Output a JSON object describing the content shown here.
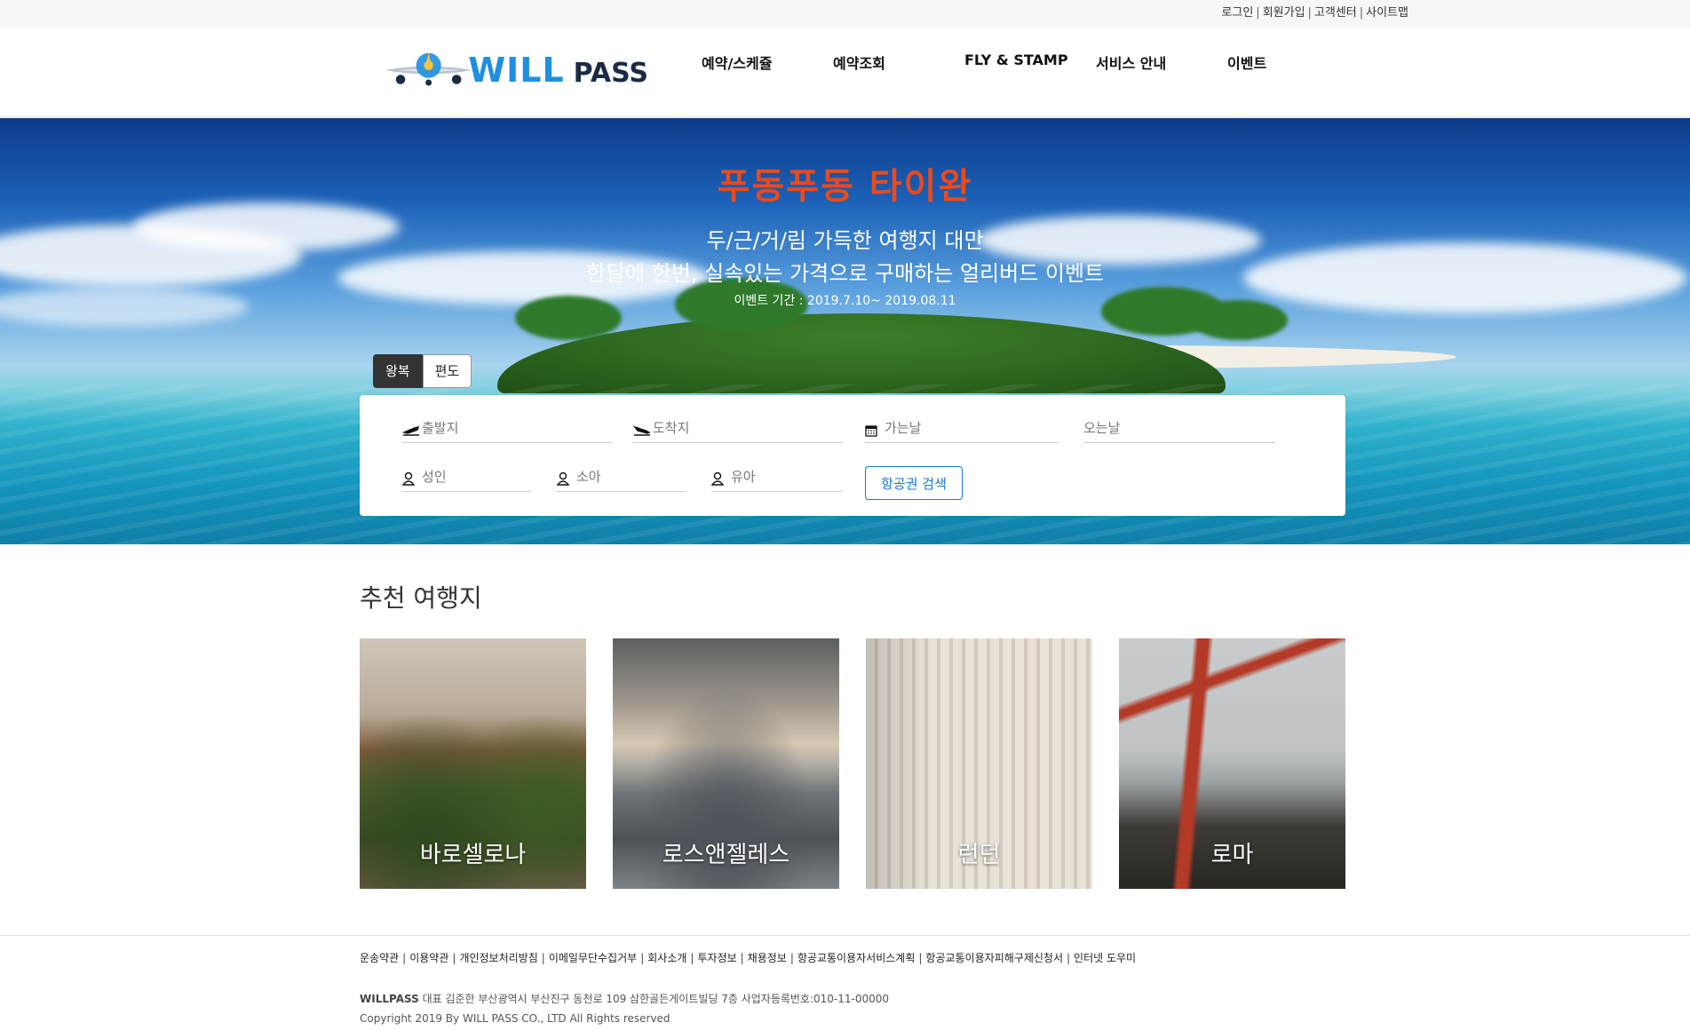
{
  "topbar": {
    "links": [
      "로그인",
      "회원가입",
      "고객센터",
      "사이트맵"
    ]
  },
  "brand": {
    "word1": "WILL",
    "word2": "PASS",
    "colors": {
      "primary": "#1f8fe0",
      "dark": "#1b2b44"
    }
  },
  "nav": {
    "items": [
      "예약/스케쥴",
      "예약조회",
      "FLY & STAMP",
      "서비스 안내",
      "이벤트"
    ]
  },
  "hero": {
    "title": "푸동푸동 타이완",
    "subtitle1": "두/근/거/림 가득한 여행지 대만",
    "subtitle2": "한달에 한번, 실속있는 가격으로 구매하는 얼리버드 이벤트",
    "period": "이벤트 기간 : 2019.7.10~ 2019.08.11",
    "title_color": "#ea4a1c"
  },
  "trip_tabs": {
    "active": "왕복",
    "inactive": "편도"
  },
  "search": {
    "departure_placeholder": "출발지",
    "arrival_placeholder": "도착지",
    "depart_date_placeholder": "가는날",
    "return_date_placeholder": "오는날",
    "adult_placeholder": "성인",
    "child_placeholder": "소아",
    "infant_placeholder": "유아",
    "button_label": "항공권 검색",
    "icons": [
      "takeoff-icon",
      "landing-icon",
      "calendar-icon",
      "person-icon"
    ]
  },
  "recommended": {
    "title": "추천 여행지",
    "destinations": [
      {
        "name": "바로셀로나"
      },
      {
        "name": "로스앤젤레스"
      },
      {
        "name": "런던"
      },
      {
        "name": "로마"
      }
    ]
  },
  "footer": {
    "links": [
      "운송약관",
      "이용약관",
      "개인정보처리방침",
      "이메일무단수집거부",
      "회사소개",
      "투자정보",
      "채용정보",
      "항공교통이용자서비스계획",
      "항공교통이용자피해구제신청서",
      "인터넷 도우미"
    ],
    "company": "WILLPASS",
    "address": "대표 김준한 부산광역시 부산진구 동천로 109 삼한골든게이트빌딩 7층 사업자등록번호:010-11-00000",
    "copyright": "Copyright 2019 By WILL PASS CO., LTD All Rights reserved"
  }
}
